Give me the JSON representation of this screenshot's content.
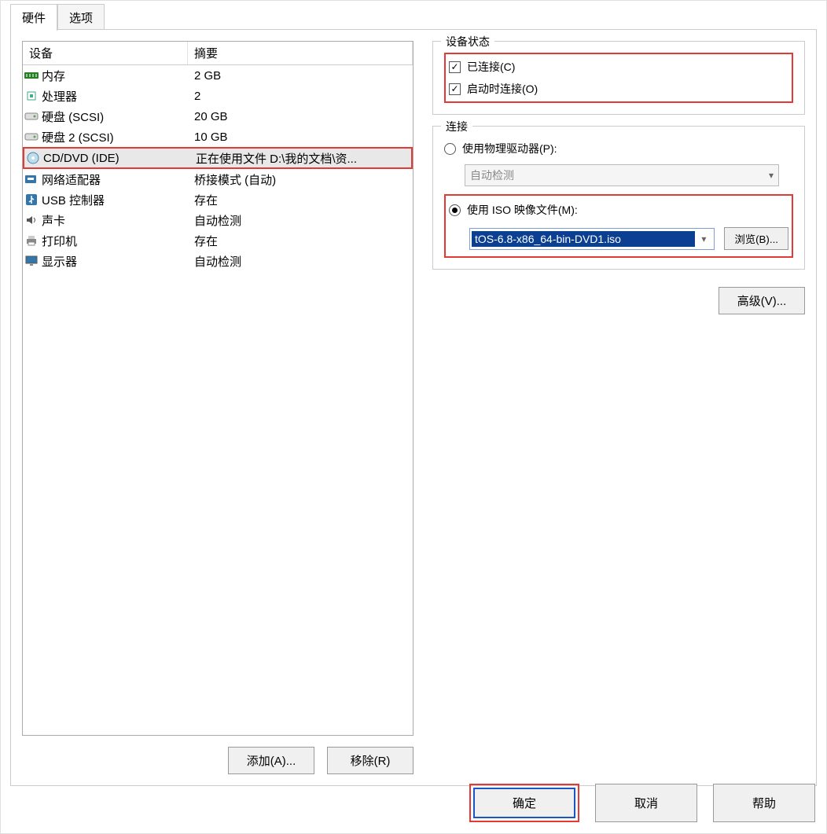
{
  "tabs": {
    "hardware": "硬件",
    "options": "选项"
  },
  "device_header": {
    "device": "设备",
    "summary": "摘要"
  },
  "devices": [
    {
      "icon": "memory-icon",
      "name": "内存",
      "summary": "2 GB"
    },
    {
      "icon": "cpu-icon",
      "name": "处理器",
      "summary": "2"
    },
    {
      "icon": "hdd-icon",
      "name": "硬盘 (SCSI)",
      "summary": "20 GB"
    },
    {
      "icon": "hdd-icon",
      "name": "硬盘 2 (SCSI)",
      "summary": "10 GB"
    },
    {
      "icon": "cd-icon",
      "name": "CD/DVD (IDE)",
      "summary": "正在使用文件 D:\\我的文档\\资..."
    },
    {
      "icon": "nic-icon",
      "name": "网络适配器",
      "summary": "桥接模式 (自动)"
    },
    {
      "icon": "usb-icon",
      "name": "USB 控制器",
      "summary": "存在"
    },
    {
      "icon": "sound-icon",
      "name": "声卡",
      "summary": "自动检测"
    },
    {
      "icon": "printer-icon",
      "name": "打印机",
      "summary": "存在"
    },
    {
      "icon": "display-icon",
      "name": "显示器",
      "summary": "自动检测"
    }
  ],
  "selected_index": 4,
  "buttons": {
    "add": "添加(A)...",
    "remove": "移除(R)",
    "ok": "确定",
    "cancel": "取消",
    "help": "帮助",
    "browse": "浏览(B)...",
    "advanced": "高级(V)..."
  },
  "status_group": {
    "title": "设备状态",
    "connected": "已连接(C)",
    "connect_at_poweron": "启动时连接(O)",
    "connected_checked": true,
    "poweron_checked": true
  },
  "conn_group": {
    "title": "连接",
    "physical_label": "使用物理驱动器(P):",
    "physical_value": "自动检测",
    "iso_label": "使用 ISO 映像文件(M):",
    "iso_value": "tOS-6.8-x86_64-bin-DVD1.iso",
    "selected": "iso"
  }
}
